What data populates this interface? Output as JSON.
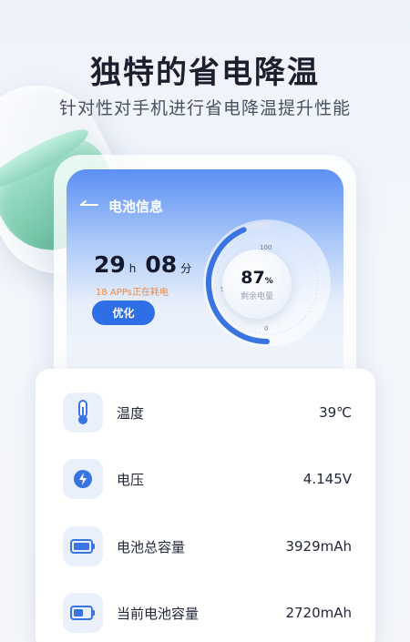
{
  "promo": {
    "headline": "独特的省电降温",
    "subline": "针对性对手机进行省电降温提升性能"
  },
  "battery_screen": {
    "title": "电池信息",
    "time": {
      "hours": "29",
      "hours_unit": "h",
      "minutes": "08",
      "minutes_unit": "分"
    },
    "apps_text": "18 APPs正在耗电",
    "optimize_label": "优化",
    "gauge": {
      "percent": "87",
      "percent_unit": "%",
      "label": "剩余电量",
      "level": 0.87,
      "ticks": [
        "100",
        "50",
        "0"
      ]
    }
  },
  "info_list": [
    {
      "icon": "thermometer-icon",
      "label": "温度",
      "value": "39℃"
    },
    {
      "icon": "lightning-icon",
      "label": "电压",
      "value": "4.145V"
    },
    {
      "icon": "battery-full-icon",
      "label": "电池总容量",
      "value": "3929mAh"
    },
    {
      "icon": "battery-half-icon",
      "label": "当前电池容量",
      "value": "2720mAh"
    }
  ],
  "colors": {
    "accent": "#2f6fe6",
    "warning_text": "#f08a3c",
    "capsule_green": "#78c9ab"
  }
}
